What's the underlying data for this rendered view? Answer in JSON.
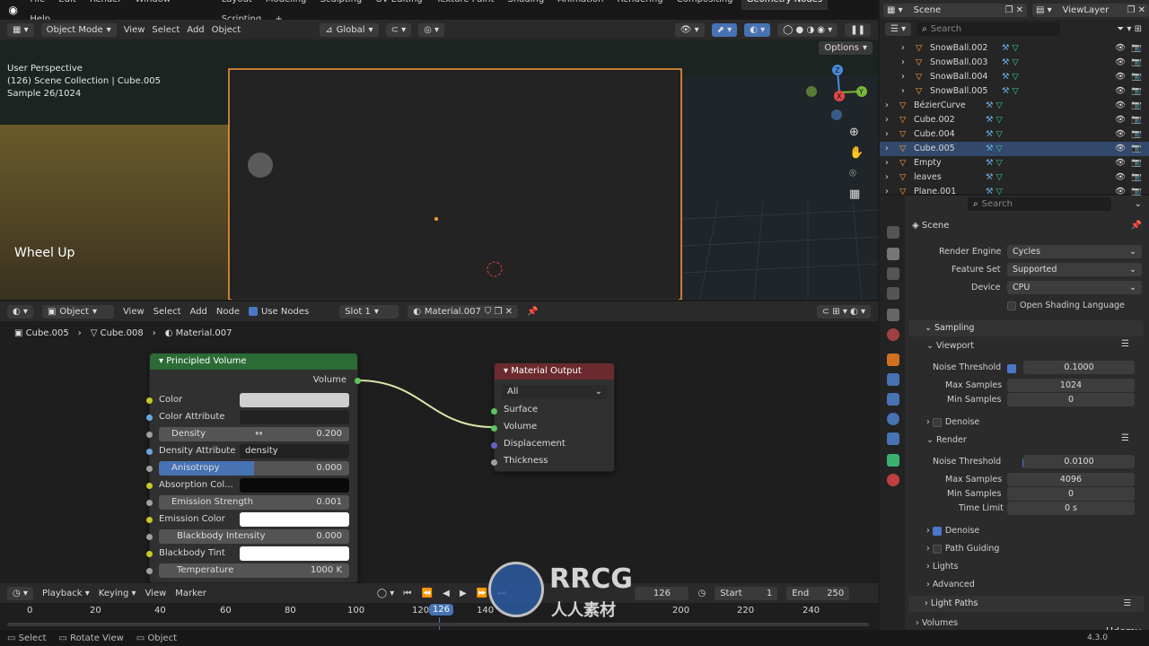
{
  "menu": [
    "File",
    "Edit",
    "Render",
    "Window",
    "Help"
  ],
  "workspaces": [
    "Layout",
    "Modeling",
    "Sculpting",
    "UV Editing",
    "Texture Paint",
    "Shading",
    "Animation",
    "Rendering",
    "Compositing",
    "Geometry Nodes",
    "Scripting"
  ],
  "active_workspace": "Geometry Nodes",
  "scene_name": "Scene",
  "view_layer": "ViewLayer",
  "viewport_header": {
    "mode": "Object Mode",
    "view": "View",
    "select": "Select",
    "add": "Add",
    "object": "Object",
    "orientation": "Global",
    "options": "Options"
  },
  "viewport_overlay": {
    "line1": "User Perspective",
    "line2": "(126) Scene Collection | Cube.005",
    "line3": "Sample 26/1024",
    "event": "Wheel Up"
  },
  "node_editor_header": {
    "type": "Object",
    "view": "View",
    "select": "Select",
    "add": "Add",
    "node": "Node",
    "use_nodes": "Use Nodes",
    "slot": "Slot 1",
    "material": "Material.007"
  },
  "breadcrumb": [
    "Cube.005",
    "Cube.008",
    "Material.007"
  ],
  "principled_volume": {
    "title": "Principled Volume",
    "output": "Volume",
    "color": "Color",
    "color_attribute": "Color Attribute",
    "density_label": "Density",
    "density_value": "0.200",
    "density_attribute_label": "Density Attribute",
    "density_attribute_value": "density",
    "anisotropy_label": "Anisotropy",
    "anisotropy_value": "0.000",
    "anisotropy_fill": 0.5,
    "absorption": "Absorption Col...",
    "emission_strength_label": "Emission Strength",
    "emission_strength_value": "0.001",
    "emission_color": "Emission Color",
    "blackbody_label": "Blackbody Intensity",
    "blackbody_value": "0.000",
    "blackbody_tint": "Blackbody Tint",
    "temperature_label": "Temperature",
    "temperature_value": "1000 K"
  },
  "material_output": {
    "title": "Material Output",
    "target": "All",
    "surface": "Surface",
    "volume": "Volume",
    "displacement": "Displacement",
    "thickness": "Thickness"
  },
  "timeline": {
    "playback": "Playback",
    "keying": "Keying",
    "view": "View",
    "marker": "Marker",
    "current": "126",
    "start_label": "Start",
    "start": "1",
    "end_label": "End",
    "end": "250",
    "ticks": [
      "0",
      "20",
      "40",
      "60",
      "80",
      "100",
      "120",
      "126",
      "140",
      "200",
      "220",
      "240"
    ]
  },
  "status": {
    "select": "Select",
    "rotate": "Rotate View",
    "object": "Object",
    "version": "4.3.0"
  },
  "outliner": {
    "search": "Search",
    "items": [
      "SnowBall.002",
      "SnowBall.003",
      "SnowBall.004",
      "SnowBall.005",
      "BézierCurve",
      "Cube.002",
      "Cube.004",
      "Cube.005",
      "Empty",
      "leaves",
      "Plane.001"
    ],
    "selected": "Cube.005"
  },
  "properties": {
    "search": "Search",
    "scene": "Scene",
    "render_engine_label": "Render Engine",
    "render_engine": "Cycles",
    "feature_set_label": "Feature Set",
    "feature_set": "Supported",
    "device_label": "Device",
    "device": "CPU",
    "osl": "Open Shading Language",
    "sampling": "Sampling",
    "viewport": "Viewport",
    "v_noise_label": "Noise Threshold",
    "v_noise": "0.1000",
    "v_max_label": "Max Samples",
    "v_max": "1024",
    "v_min_label": "Min Samples",
    "v_min": "0",
    "denoise": "Denoise",
    "render": "Render",
    "r_noise_label": "Noise Threshold",
    "r_noise": "0.0100",
    "r_max_label": "Max Samples",
    "r_max": "4096",
    "r_min_label": "Min Samples",
    "r_min": "0",
    "time_limit_label": "Time Limit",
    "time_limit": "0 s",
    "denoise2": "Denoise",
    "path_guiding": "Path Guiding",
    "lights": "Lights",
    "advanced": "Advanced",
    "light_paths": "Light Paths",
    "volumes": "Volumes"
  },
  "watermark": {
    "brand": "RRCG",
    "sub": "人人素材",
    "udemy": "Udemy"
  },
  "colors": {
    "accent": "#4772b3",
    "node_green": "#2b6b35",
    "node_red": "#6b2b2e",
    "selection": "#ff9a3a"
  }
}
